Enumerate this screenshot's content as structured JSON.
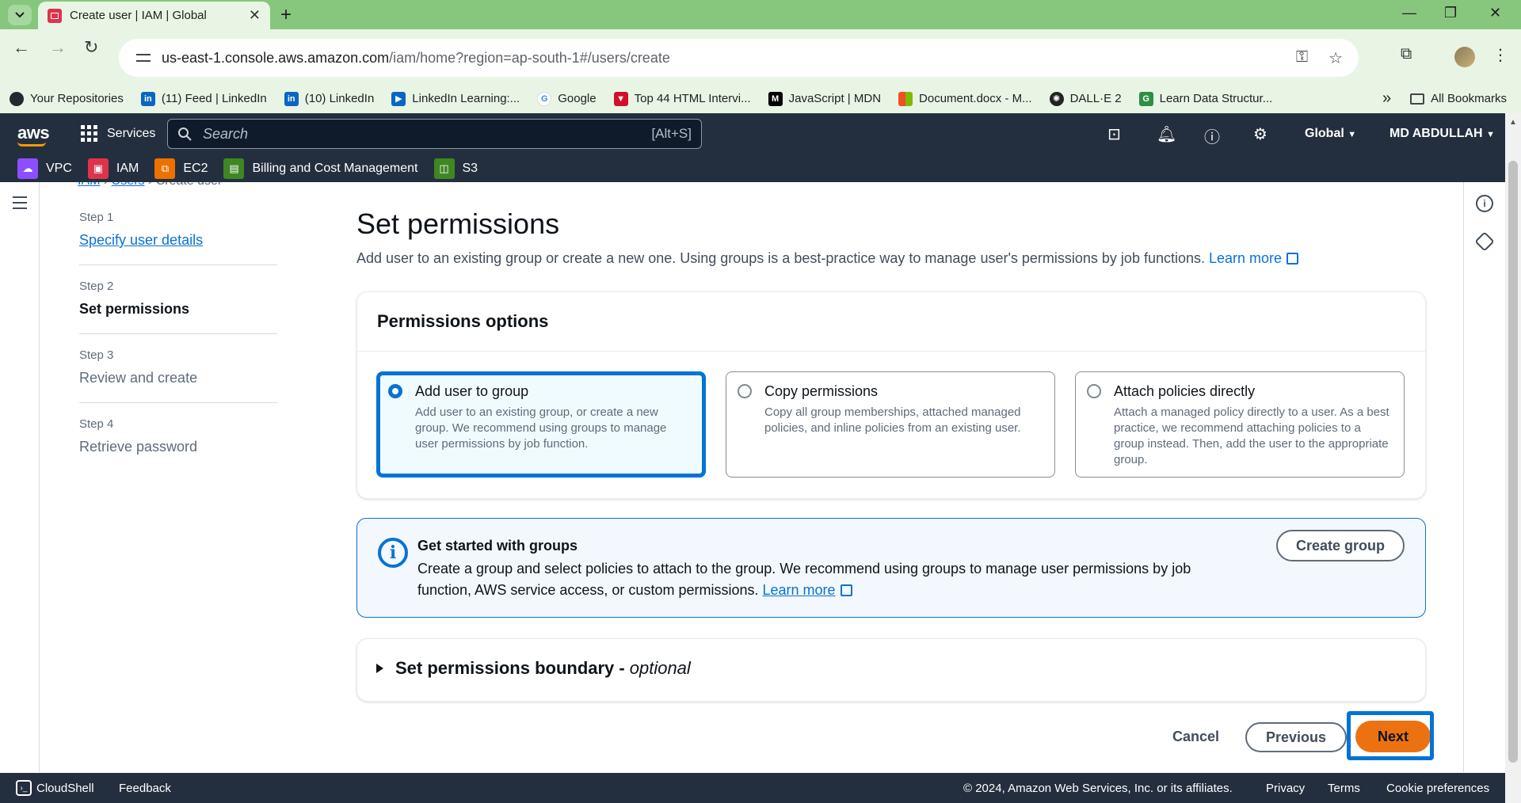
{
  "browser": {
    "tab_title": "Create user | IAM | Global",
    "url_host": "us-east-1.console.aws.amazon.com",
    "url_path": "/iam/home?region=ap-south-1#/users/create",
    "bookmarks": [
      {
        "label": "Your Repositories",
        "icon": "github-icon",
        "color": "#24292f"
      },
      {
        "label": "(11) Feed | LinkedIn",
        "icon": "linkedin-icon",
        "color": "#0a66c2"
      },
      {
        "label": "(10) LinkedIn",
        "icon": "linkedin-icon",
        "color": "#0a66c2"
      },
      {
        "label": "LinkedIn Learning:...",
        "icon": "linkedin-learning-icon",
        "color": "#0a66c2"
      },
      {
        "label": "Google",
        "icon": "google-icon",
        "color": "#4285f4"
      },
      {
        "label": "Top 44 HTML Intervi...",
        "icon": "bookmark-icon",
        "color": "#d0112b"
      },
      {
        "label": "JavaScript | MDN",
        "icon": "mdn-icon",
        "color": "#000000"
      },
      {
        "label": "Document.docx - M...",
        "icon": "microsoft-icon",
        "color": "#f25022"
      },
      {
        "label": "DALL·E 2",
        "icon": "openai-icon",
        "color": "#222222"
      },
      {
        "label": "Learn Data Structur...",
        "icon": "gfg-icon",
        "color": "#2f8d46"
      }
    ],
    "all_bookmarks": "All Bookmarks"
  },
  "aws_nav": {
    "logo": "aws",
    "services": "Services",
    "search_placeholder": "Search",
    "search_shortcut": "[Alt+S]",
    "region": "Global",
    "account": "MD ABDULLAH",
    "favorites": [
      {
        "label": "VPC",
        "icon": "vpc-icon",
        "color": "#8c4fff"
      },
      {
        "label": "IAM",
        "icon": "iam-icon",
        "color": "#dd344c"
      },
      {
        "label": "EC2",
        "icon": "ec2-icon",
        "color": "#ed7100"
      },
      {
        "label": "Billing and Cost Management",
        "icon": "billing-icon",
        "color": "#3f8624"
      },
      {
        "label": "S3",
        "icon": "s3-icon",
        "color": "#3f8624"
      }
    ]
  },
  "breadcrumb": {
    "iam": "IAM",
    "users": "Users",
    "current": "Create user"
  },
  "steps": [
    {
      "num": "Step 1",
      "label": "Specify user details"
    },
    {
      "num": "Step 2",
      "label": "Set permissions"
    },
    {
      "num": "Step 3",
      "label": "Review and create"
    },
    {
      "num": "Step 4",
      "label": "Retrieve password"
    }
  ],
  "page": {
    "title": "Set permissions",
    "description": "Add user to an existing group or create a new one. Using groups is a best-practice way to manage user's permissions by job functions.",
    "learn_more": "Learn more"
  },
  "permissions": {
    "heading": "Permissions options",
    "options": [
      {
        "title": "Add user to group",
        "desc": "Add user to an existing group, or create a new group. We recommend using groups to manage user permissions by job function.",
        "selected": true
      },
      {
        "title": "Copy permissions",
        "desc": "Copy all group memberships, attached managed policies, and inline policies from an existing user.",
        "selected": false
      },
      {
        "title": "Attach policies directly",
        "desc": "Attach a managed policy directly to a user. As a best practice, we recommend attaching policies to a group instead. Then, add the user to the appropriate group.",
        "selected": false
      }
    ]
  },
  "alert": {
    "title": "Get started with groups",
    "body": "Create a group and select policies to attach to the group. We recommend using groups to manage user permissions by job function, AWS service access, or custom permissions.",
    "learn_more": "Learn more",
    "button": "Create group"
  },
  "boundary": {
    "title": "Set permissions boundary -",
    "optional": "optional"
  },
  "actions": {
    "cancel": "Cancel",
    "previous": "Previous",
    "next": "Next"
  },
  "footer": {
    "cloudshell": "CloudShell",
    "feedback": "Feedback",
    "copyright": "© 2024, Amazon Web Services, Inc. or its affiliates.",
    "privacy": "Privacy",
    "terms": "Terms",
    "cookies": "Cookie preferences"
  },
  "colors": {
    "accent": "#0972d3",
    "primary_button": "#ec7211",
    "nav_bg": "#232f3e",
    "highlight": "#0073d6"
  }
}
